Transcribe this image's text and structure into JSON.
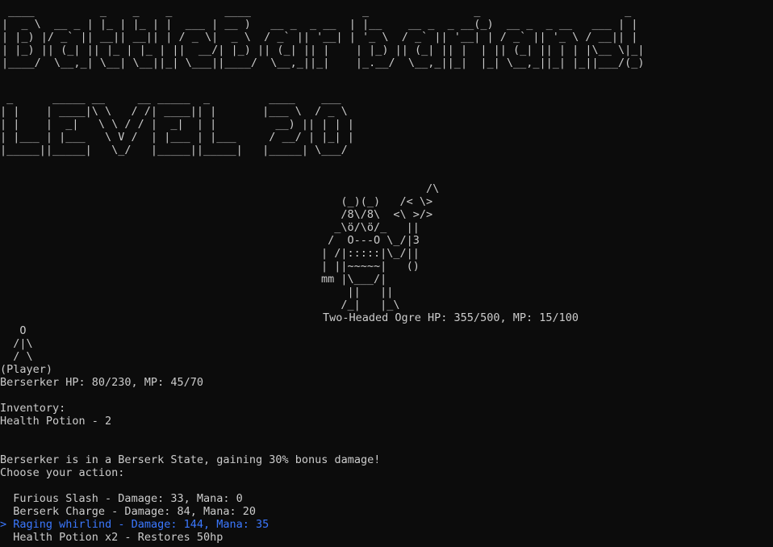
{
  "title_banner": {
    "text": "BattleBarbarians!",
    "lines": [
      " ____          _    _    _        ____                 _                _                      _ ",
      "|  _ \\  __ _ | |_ | |_ | |  ___ | __ )   __ _  _ __  | |__    __ _  _ __(_)  __ _  _ __   ___ | |",
      "| |_) |/ _` || __|| __|| | / _ \\|  _ \\  / _` || '__| | '_ \\  / _` || '__| | / _` || '_ \\ / __|| |",
      "| |_) || (_| || |_ | |_ | ||  __/| |_) || (_| || |    | |_) || (_| || |  | || (_| || | | |\\__ \\|_|",
      "|____/  \\__,_| \\__| \\__||_| \\___||____/  \\__,_||_|    |_.__/  \\__,_||_|  |_| \\__,_||_| |_||___/(_)"
    ]
  },
  "level_banner": {
    "text": "LEVEL 20",
    "lines": [
      " _      _____ __     __ _____  _         ____    ___  ",
      "| |    | ____|\\ \\   / /| ____|| |       |___ \\  / _ \\ ",
      "| |    |  _|   \\ \\ / / |  _|  | |         __) || | | |",
      "| |___ | |___   \\ V /  | |___ | |___     / __/ | |_| |",
      "|_____||_____|   \\_/   |_____||_____|   |_____| \\___/ "
    ]
  },
  "enemy": {
    "art": [
      "                /\\",
      "   (_)(_)   /< \\>",
      "   /8\\/8\\  <\\ >/>",
      "  _\\ö/\\ö/_   ||",
      " /  O---O \\_/|3",
      "| /|:::::|\\_/||",
      "| ||~~~~~|   ()",
      "mm |\\___/|",
      "    ||   ||",
      "   /_|   |_\\"
    ],
    "status": "Two-Headed Ogre HP: 355/500, MP: 15/100"
  },
  "player": {
    "art": [
      "   O",
      "  /|\\",
      "  / \\"
    ],
    "tag": "(Player)",
    "status": "Berserker HP: 80/230, MP: 45/70"
  },
  "inventory": {
    "header": "Inventory:",
    "items": [
      "Health Potion - 2"
    ]
  },
  "messages": {
    "berserk": "Berserker is in a Berserk State, gaining 30% bonus damage!",
    "prompt": "Choose your action:"
  },
  "actions": [
    {
      "label": "Furious Slash - Damage: 33, Mana: 0"
    },
    {
      "label": "Berserk Charge - Damage: 84, Mana: 20"
    },
    {
      "label": "Raging whirlind - Damage: 144, Mana: 35"
    },
    {
      "label": "Health Potion x2 - Restores 50hp"
    }
  ],
  "selected_action_index": 2,
  "selection_pointer": ">",
  "colors": {
    "background": "#0c0c0c",
    "text": "#cccccc",
    "highlight": "#3b78ff"
  }
}
